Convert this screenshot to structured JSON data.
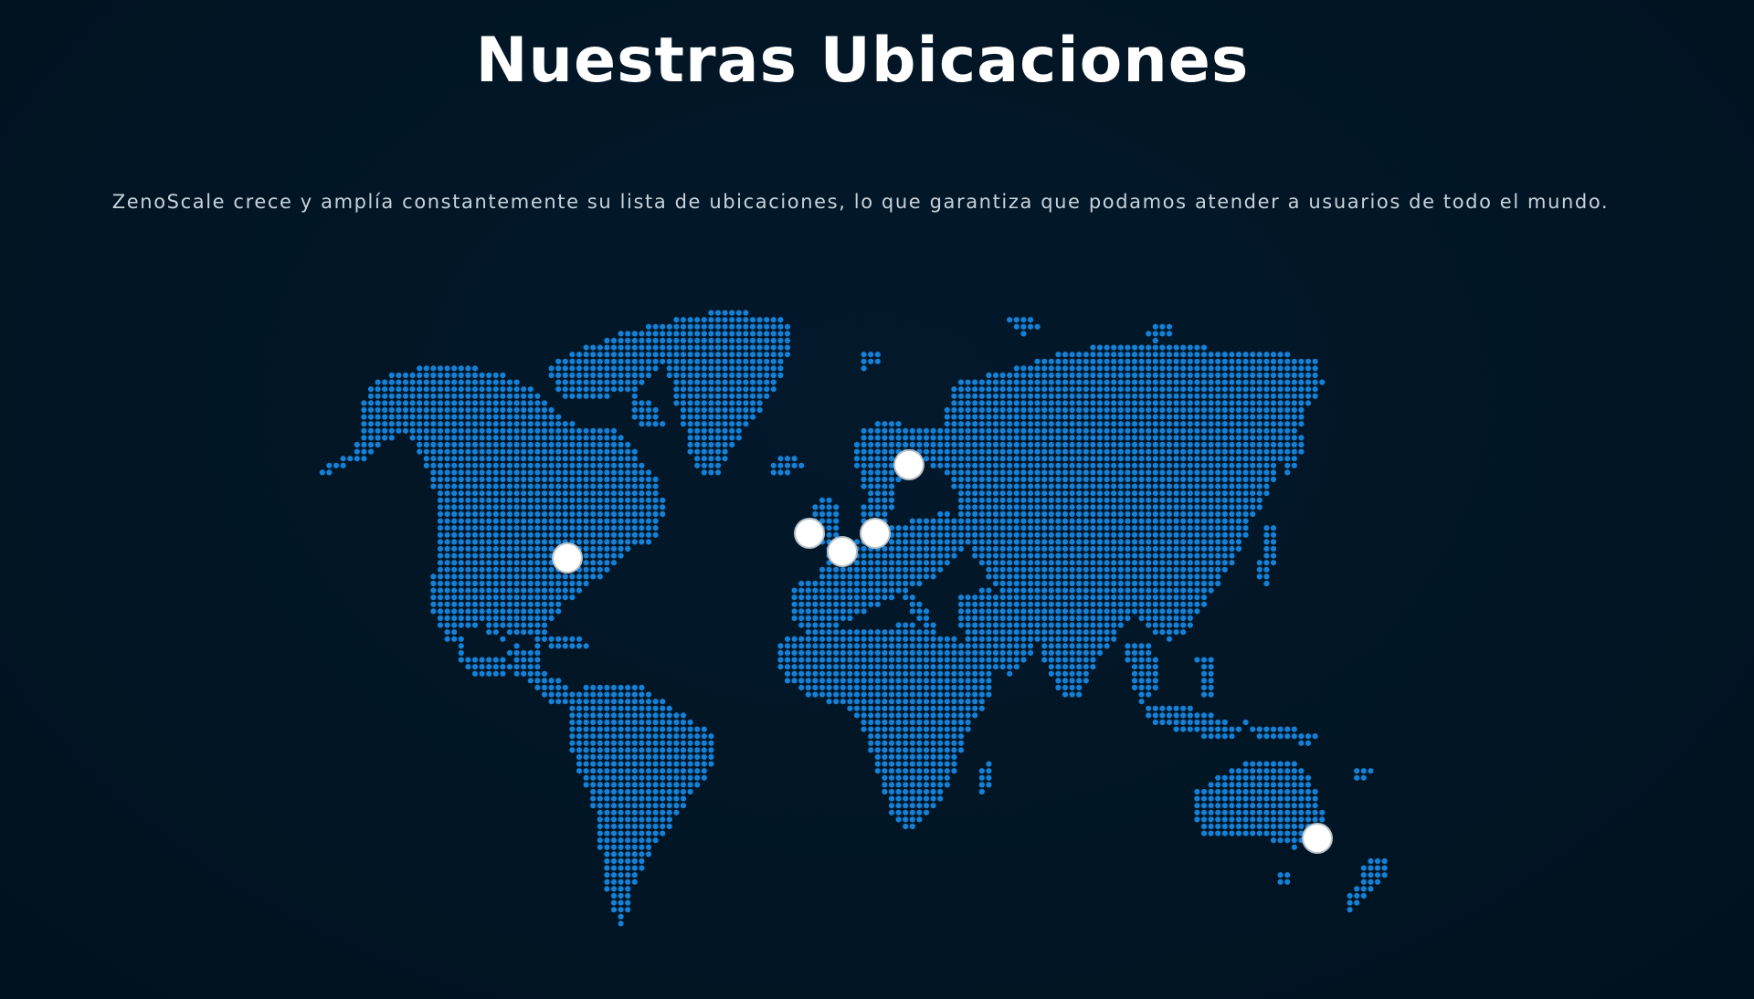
{
  "section": {
    "title": "Nuestras Ubicaciones",
    "subtitle": "ZenoScale crece y amplía constantemente su lista de ubicaciones, lo que garantiza que podamos atender a usuarios de todo el mundo."
  },
  "map": {
    "style": "dotted-world-map",
    "dot_color": "#1481d6",
    "marker_color": "#ffffff",
    "background_color": "#011524",
    "markers_count_visible": 6
  },
  "colors": {
    "background": "#011524",
    "title": "#ffffff",
    "subtitle": "#c9d2da",
    "accent": "#1481d6"
  }
}
